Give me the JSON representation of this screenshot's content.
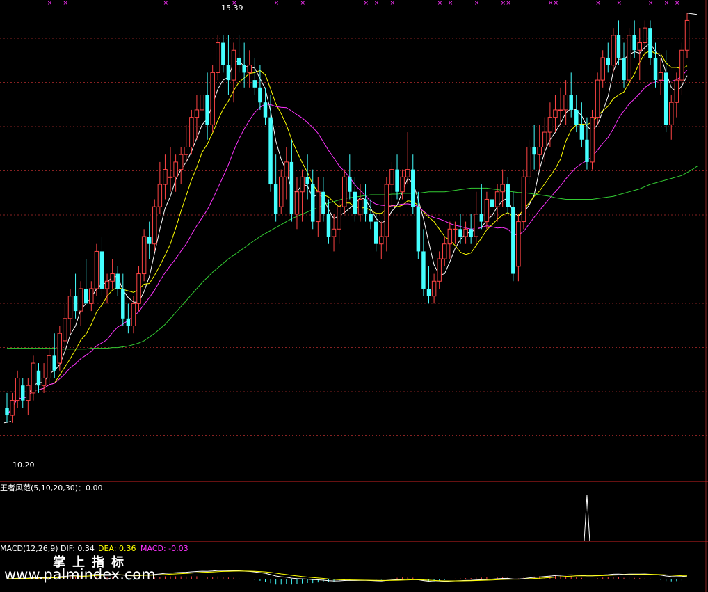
{
  "chart_data": {
    "type": "candlestick",
    "y_range": [
      9.6,
      15.8
    ],
    "high_label": "15.39",
    "low_label": "10.20",
    "ma_colors": [
      "#ffffff",
      "#ffff00",
      "#ff33ff",
      "#33cc33"
    ],
    "up_color": "#ff4444",
    "down_color": "#44ffff",
    "candles": [
      [
        10.4,
        10.6,
        10.2,
        10.3
      ],
      [
        10.3,
        10.6,
        10.2,
        10.5
      ],
      [
        10.5,
        10.9,
        10.4,
        10.8
      ],
      [
        10.7,
        10.8,
        10.4,
        10.5
      ],
      [
        10.5,
        10.8,
        10.3,
        10.7
      ],
      [
        10.6,
        11.1,
        10.5,
        11.0
      ],
      [
        10.9,
        11.0,
        10.6,
        10.7
      ],
      [
        10.7,
        11.0,
        10.6,
        10.8
      ],
      [
        10.8,
        11.2,
        10.7,
        11.1
      ],
      [
        11.1,
        11.4,
        10.8,
        10.9
      ],
      [
        11.0,
        11.5,
        10.9,
        11.4
      ],
      [
        11.3,
        11.8,
        11.2,
        11.6
      ],
      [
        11.6,
        12.0,
        11.4,
        11.9
      ],
      [
        11.9,
        12.2,
        11.6,
        11.7
      ],
      [
        11.7,
        12.1,
        11.5,
        12.0
      ],
      [
        12.0,
        12.4,
        11.8,
        11.8
      ],
      [
        11.8,
        12.1,
        11.7,
        12.0
      ],
      [
        12.0,
        12.6,
        11.9,
        12.5
      ],
      [
        12.5,
        12.7,
        11.9,
        12.0
      ],
      [
        12.0,
        12.2,
        11.8,
        12.1
      ],
      [
        12.1,
        12.4,
        12.0,
        12.2
      ],
      [
        12.2,
        12.3,
        11.9,
        12.0
      ],
      [
        12.0,
        12.2,
        11.5,
        11.6
      ],
      [
        11.6,
        11.8,
        11.4,
        11.5
      ],
      [
        11.5,
        11.9,
        11.4,
        11.8
      ],
      [
        11.8,
        12.3,
        11.7,
        12.2
      ],
      [
        12.2,
        12.8,
        12.1,
        12.7
      ],
      [
        12.7,
        12.9,
        12.4,
        12.6
      ],
      [
        12.6,
        13.2,
        12.5,
        13.1
      ],
      [
        13.1,
        13.7,
        13.0,
        13.4
      ],
      [
        13.4,
        13.8,
        13.2,
        13.6
      ],
      [
        13.5,
        13.9,
        13.3,
        13.5
      ],
      [
        13.5,
        13.8,
        13.3,
        13.7
      ],
      [
        13.6,
        13.9,
        13.4,
        13.8
      ],
      [
        13.8,
        14.2,
        13.7,
        13.9
      ],
      [
        13.9,
        14.4,
        13.8,
        14.3
      ],
      [
        14.3,
        14.6,
        14.0,
        14.4
      ],
      [
        14.4,
        14.8,
        14.2,
        14.6
      ],
      [
        14.6,
        14.9,
        14.0,
        14.2
      ],
      [
        14.2,
        15.0,
        14.1,
        14.9
      ],
      [
        14.9,
        15.4,
        14.8,
        15.3
      ],
      [
        15.3,
        15.4,
        14.9,
        15.0
      ],
      [
        15.0,
        15.4,
        14.6,
        14.8
      ],
      [
        14.8,
        15.3,
        14.5,
        15.2
      ],
      [
        15.1,
        15.4,
        14.9,
        15.0
      ],
      [
        15.0,
        15.3,
        14.7,
        14.9
      ],
      [
        14.9,
        15.2,
        14.7,
        15.0
      ],
      [
        14.8,
        15.1,
        14.6,
        14.7
      ],
      [
        14.7,
        15.0,
        14.4,
        14.5
      ],
      [
        14.5,
        14.7,
        14.2,
        14.3
      ],
      [
        14.3,
        14.6,
        13.3,
        13.4
      ],
      [
        13.4,
        13.8,
        12.9,
        13.0
      ],
      [
        13.1,
        13.6,
        13.0,
        13.5
      ],
      [
        13.5,
        13.9,
        13.2,
        13.7
      ],
      [
        13.7,
        14.0,
        12.9,
        13.0
      ],
      [
        13.0,
        13.5,
        12.8,
        13.3
      ],
      [
        13.3,
        13.6,
        12.9,
        13.5
      ],
      [
        13.5,
        13.8,
        13.2,
        13.4
      ],
      [
        13.4,
        13.6,
        12.8,
        12.9
      ],
      [
        12.9,
        13.5,
        12.7,
        13.3
      ],
      [
        13.3,
        13.5,
        12.9,
        13.0
      ],
      [
        13.0,
        13.2,
        12.6,
        12.7
      ],
      [
        12.7,
        13.0,
        12.5,
        12.8
      ],
      [
        12.8,
        13.2,
        12.6,
        13.1
      ],
      [
        13.1,
        13.6,
        13.0,
        13.5
      ],
      [
        13.5,
        13.8,
        13.2,
        13.3
      ],
      [
        13.3,
        13.5,
        12.9,
        13.0
      ],
      [
        13.0,
        13.4,
        12.9,
        13.2
      ],
      [
        13.2,
        13.4,
        12.9,
        13.0
      ],
      [
        13.0,
        13.2,
        12.8,
        12.9
      ],
      [
        12.9,
        13.0,
        12.5,
        12.6
      ],
      [
        12.6,
        12.9,
        12.4,
        12.7
      ],
      [
        12.7,
        13.5,
        12.5,
        13.4
      ],
      [
        13.4,
        13.7,
        13.1,
        13.6
      ],
      [
        13.6,
        13.8,
        13.2,
        13.3
      ],
      [
        13.3,
        13.6,
        13.2,
        13.5
      ],
      [
        13.5,
        14.1,
        13.4,
        13.6
      ],
      [
        13.6,
        13.8,
        13.0,
        13.1
      ],
      [
        13.1,
        13.3,
        12.4,
        12.5
      ],
      [
        12.5,
        12.8,
        11.9,
        12.0
      ],
      [
        12.0,
        12.3,
        11.8,
        11.9
      ],
      [
        11.9,
        12.2,
        11.8,
        12.1
      ],
      [
        12.1,
        12.5,
        12.0,
        12.4
      ],
      [
        12.4,
        12.7,
        12.3,
        12.6
      ],
      [
        12.6,
        12.9,
        12.4,
        12.8
      ],
      [
        12.8,
        12.9,
        12.6,
        12.8
      ],
      [
        12.8,
        13.0,
        12.6,
        12.7
      ],
      [
        12.7,
        12.9,
        12.6,
        12.8
      ],
      [
        12.8,
        13.0,
        12.6,
        12.7
      ],
      [
        12.7,
        13.3,
        12.6,
        13.0
      ],
      [
        13.0,
        13.4,
        12.8,
        12.9
      ],
      [
        12.9,
        13.3,
        12.8,
        13.2
      ],
      [
        13.2,
        13.5,
        13.0,
        13.1
      ],
      [
        13.1,
        13.4,
        12.9,
        13.3
      ],
      [
        13.3,
        13.6,
        13.1,
        13.4
      ],
      [
        13.4,
        13.5,
        13.0,
        13.1
      ],
      [
        13.1,
        13.3,
        12.1,
        12.2
      ],
      [
        12.3,
        13.0,
        12.1,
        12.9
      ],
      [
        12.9,
        13.6,
        12.8,
        13.5
      ],
      [
        13.5,
        14.0,
        13.4,
        13.9
      ],
      [
        13.9,
        14.2,
        13.6,
        13.8
      ],
      [
        13.8,
        14.2,
        13.6,
        13.9
      ],
      [
        13.9,
        14.3,
        13.7,
        14.1
      ],
      [
        14.1,
        14.5,
        13.9,
        14.3
      ],
      [
        14.3,
        14.6,
        14.1,
        14.4
      ],
      [
        14.4,
        14.7,
        14.2,
        14.4
      ],
      [
        14.4,
        14.8,
        14.2,
        14.6
      ],
      [
        14.6,
        14.9,
        14.3,
        14.4
      ],
      [
        14.4,
        14.6,
        14.1,
        14.2
      ],
      [
        14.2,
        14.5,
        13.9,
        14.0
      ],
      [
        14.0,
        14.3,
        13.6,
        13.7
      ],
      [
        13.7,
        14.4,
        13.6,
        14.3
      ],
      [
        14.3,
        14.9,
        14.2,
        14.8
      ],
      [
        14.8,
        15.2,
        14.7,
        15.1
      ],
      [
        15.1,
        15.3,
        14.9,
        15.0
      ],
      [
        15.0,
        15.5,
        14.9,
        15.4
      ],
      [
        15.4,
        15.6,
        15.0,
        15.1
      ],
      [
        15.1,
        15.3,
        14.7,
        14.8
      ],
      [
        14.8,
        15.5,
        14.7,
        15.4
      ],
      [
        15.4,
        15.6,
        15.1,
        15.2
      ],
      [
        15.2,
        15.5,
        14.8,
        15.3
      ],
      [
        15.3,
        15.6,
        15.1,
        15.5
      ],
      [
        15.5,
        15.6,
        15.0,
        15.1
      ],
      [
        15.1,
        15.3,
        14.7,
        14.8
      ],
      [
        14.8,
        15.1,
        14.6,
        14.9
      ],
      [
        14.9,
        15.2,
        14.1,
        14.2
      ],
      [
        14.2,
        14.6,
        14.0,
        14.5
      ],
      [
        14.5,
        14.9,
        14.3,
        14.8
      ],
      [
        14.8,
        15.3,
        14.6,
        15.2
      ],
      [
        15.2,
        15.7,
        15.1,
        15.6
      ]
    ],
    "ma60": [
      11.2,
      11.2,
      11.2,
      11.2,
      11.2,
      11.2,
      11.2,
      11.2,
      11.2,
      11.2,
      11.19,
      11.19,
      11.19,
      11.19,
      11.19,
      11.19,
      11.2,
      11.2,
      11.2,
      11.2,
      11.21,
      11.21,
      11.22,
      11.23,
      11.25,
      11.27,
      11.3,
      11.35,
      11.4,
      11.46,
      11.52,
      11.6,
      11.68,
      11.76,
      11.84,
      11.92,
      12.0,
      12.08,
      12.15,
      12.22,
      12.28,
      12.34,
      12.4,
      12.45,
      12.5,
      12.55,
      12.6,
      12.65,
      12.7,
      12.74,
      12.78,
      12.82,
      12.86,
      12.9,
      12.94,
      12.97,
      13.0,
      13.03,
      13.06,
      13.09,
      13.12,
      13.15,
      13.17,
      13.19,
      13.21,
      13.22,
      13.23,
      13.24,
      13.25,
      13.26,
      13.26,
      13.26,
      13.26,
      13.27,
      13.27,
      13.28,
      13.28,
      13.28,
      13.28,
      13.29,
      13.3,
      13.3,
      13.3,
      13.3,
      13.31,
      13.32,
      13.33,
      13.34,
      13.35,
      13.35,
      13.35,
      13.35,
      13.34,
      13.33,
      13.32,
      13.31,
      13.3,
      13.29,
      13.29,
      13.28,
      13.27,
      13.26,
      13.25,
      13.24,
      13.22,
      13.21,
      13.2,
      13.2,
      13.2,
      13.2,
      13.2,
      13.2,
      13.21,
      13.22,
      13.23,
      13.24,
      13.26,
      13.28,
      13.3,
      13.32,
      13.34,
      13.37,
      13.4,
      13.42,
      13.44,
      13.46,
      13.48,
      13.5,
      13.52,
      13.56,
      13.6,
      13.65
    ]
  },
  "indicator1": {
    "title": "王者风范(5,10,20,30)：0.00",
    "values": []
  },
  "macd": {
    "title": "MACD(12,26,9)",
    "dif_label": "DIF: 0.34",
    "dea_label": "DEA: 0.36",
    "macd_label": "MACD: -0.03",
    "dif_color": "#ffffff",
    "dea_color": "#ffff00",
    "macd_color": "#ff33ff"
  },
  "watermark": {
    "cn": "掌上指标",
    "url": "www.palmindex.com"
  }
}
